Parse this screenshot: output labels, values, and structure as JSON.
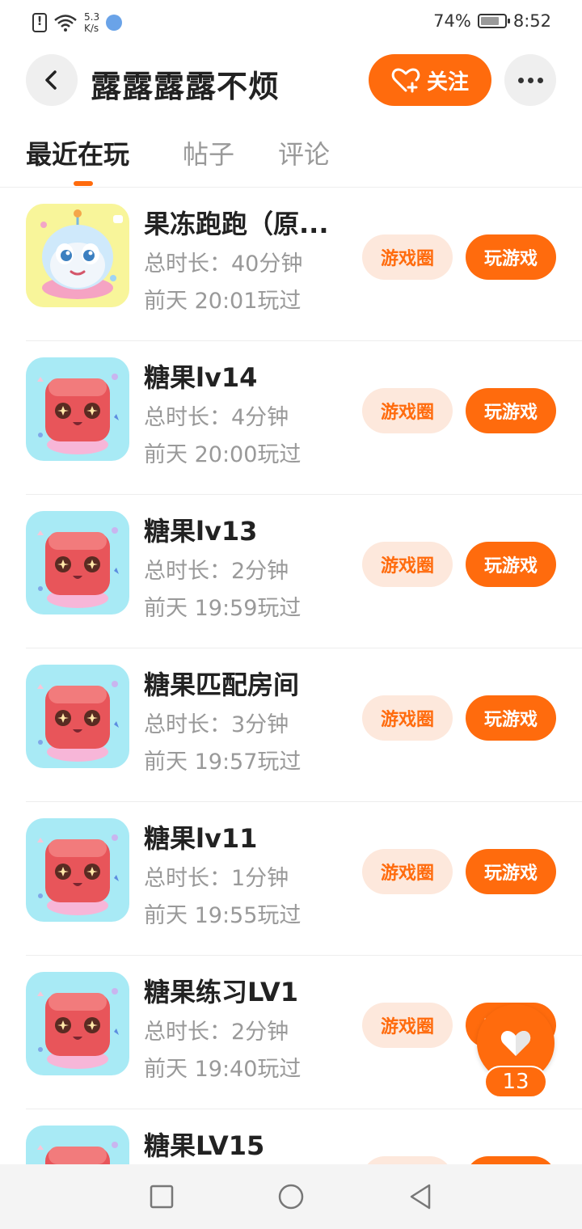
{
  "status_bar": {
    "net_speed_value": "5.3",
    "net_speed_unit": "K/s",
    "battery": "74%",
    "time": "8:52"
  },
  "header": {
    "title": "露露露露不烦",
    "follow_label": "关注"
  },
  "tabs": [
    {
      "label": "最近在玩",
      "active": true
    },
    {
      "label": "帖子",
      "active": false
    },
    {
      "label": "评论",
      "active": false
    }
  ],
  "games": [
    {
      "name": "果冻跑跑（原...",
      "duration": "总时长：40分钟",
      "last_played": "前天 20:01玩过",
      "circle_label": "游戏圈",
      "play_label": "玩游戏",
      "icon": "jelly-runner-icon"
    },
    {
      "name": "糖果lv14",
      "duration": "总时长：4分钟",
      "last_played": "前天 20:00玩过",
      "circle_label": "游戏圈",
      "play_label": "玩游戏",
      "icon": "candy-cube-icon"
    },
    {
      "name": "糖果lv13",
      "duration": "总时长：2分钟",
      "last_played": "前天 19:59玩过",
      "circle_label": "游戏圈",
      "play_label": "玩游戏",
      "icon": "candy-cube-icon"
    },
    {
      "name": "糖果匹配房间",
      "duration": "总时长：3分钟",
      "last_played": "前天 19:57玩过",
      "circle_label": "游戏圈",
      "play_label": "玩游戏",
      "icon": "candy-cube-icon"
    },
    {
      "name": "糖果lv11",
      "duration": "总时长：1分钟",
      "last_played": "前天 19:55玩过",
      "circle_label": "游戏圈",
      "play_label": "玩游戏",
      "icon": "candy-cube-icon"
    },
    {
      "name": "糖果练习LV1",
      "duration": "总时长：2分钟",
      "last_played": "前天 19:40玩过",
      "circle_label": "游戏圈",
      "play_label": "玩游戏",
      "icon": "candy-cube-icon"
    },
    {
      "name": "糖果LV15",
      "duration": "",
      "last_played": "",
      "circle_label": "",
      "play_label": "",
      "icon": "candy-cube-icon"
    }
  ],
  "like": {
    "count": "13"
  },
  "colors": {
    "accent": "#ff6b0d",
    "accent_light": "#fde8dc",
    "text_primary": "#222222",
    "text_secondary": "#999999"
  }
}
